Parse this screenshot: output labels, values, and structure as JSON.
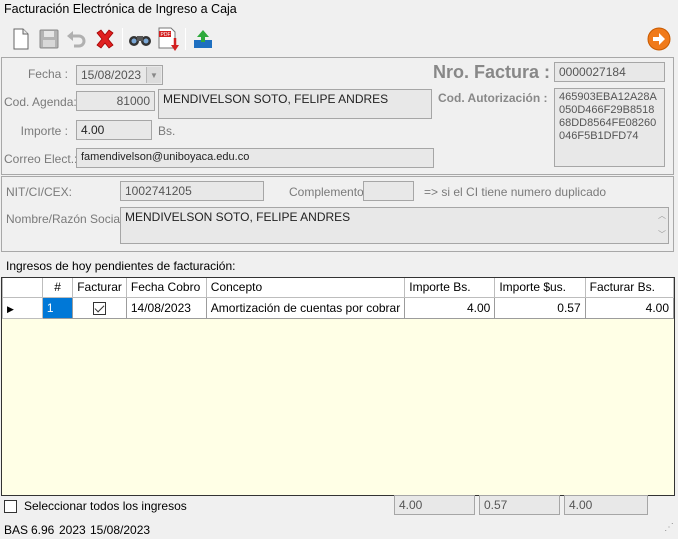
{
  "window": {
    "title": "Facturación Electrónica de Ingreso a Caja"
  },
  "toolbar": {
    "buttons": [
      {
        "icon": "new-document-icon"
      },
      {
        "icon": "save-icon"
      },
      {
        "icon": "undo-icon"
      },
      {
        "icon": "delete-icon"
      },
      {
        "icon": "binoculars-icon"
      },
      {
        "icon": "pdf-download-icon"
      },
      {
        "icon": "export-icon"
      },
      {
        "icon": "exit-arrow-icon"
      }
    ]
  },
  "header": {
    "fecha_label": "Fecha :",
    "fecha_value": "15/08/2023",
    "nro_factura_label": "Nro. Factura :",
    "nro_factura_value": "0000027184",
    "cod_agenda_label": "Cod. Agenda:",
    "cod_agenda_value": "81000",
    "cod_agenda_name": "MENDIVELSON SOTO, FELIPE ANDRES",
    "cod_autorizacion_label": "Cod. Autorización :",
    "cod_autorizacion_lines": [
      "465903EBA12A28A",
      "050D466F29B8518",
      "68DD8564FE08260",
      "046F5B1DFD74"
    ],
    "importe_label": "Importe :",
    "importe_value": "4.00",
    "importe_unit": "Bs.",
    "correo_label": "Correo Elect.:",
    "correo_value": "famendivelson@uniboyaca.edu.co"
  },
  "client": {
    "nit_label": "NIT/CI/CEX:",
    "nit_value": "1002741205",
    "complemento_label": "Complemento:",
    "complemento_value": "",
    "complemento_hint": "=> si el CI tiene numero duplicado",
    "razon_label": "Nombre/Razón Social :",
    "razon_value": "MENDIVELSON SOTO, FELIPE ANDRES"
  },
  "grid": {
    "title": "Ingresos de hoy pendientes de facturación:",
    "columns": [
      "#",
      "Facturar",
      "Fecha Cobro",
      "Concepto",
      "Importe Bs.",
      "Importe $us.",
      "Facturar Bs."
    ],
    "rows": [
      {
        "num": "1",
        "facturar": true,
        "fecha": "14/08/2023",
        "concepto": "Amortización de cuentas por cobrar",
        "importe_bs": "4.00",
        "importe_us": "0.57",
        "facturar_bs": "4.00"
      }
    ]
  },
  "footer": {
    "select_all_label": "Seleccionar todos los ingresos",
    "total_importe_bs": "4.00",
    "total_importe_us": "0.57",
    "total_facturar_bs": "4.00"
  },
  "statusbar": {
    "system": "BAS",
    "version": "6.96",
    "year": "2023",
    "date": "15/08/2023"
  }
}
